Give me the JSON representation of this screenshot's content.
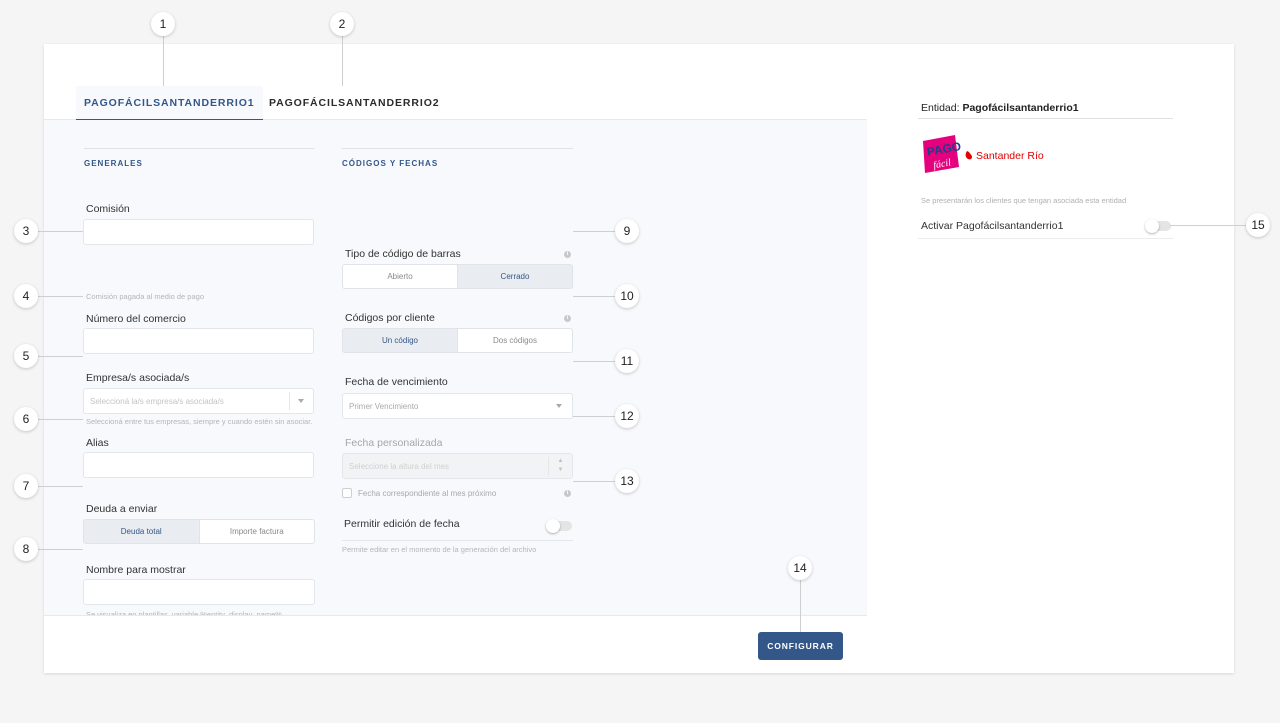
{
  "tabs": [
    {
      "label": "PAGOFÁCILSANTANDERRIO1",
      "active": true
    },
    {
      "label": "PAGOFÁCILSANTANDERRIO2",
      "active": false
    }
  ],
  "sections": {
    "generales": "GENERALES",
    "codigos": "CÓDIGOS Y FECHAS"
  },
  "generales": {
    "comision_label": "Comisión",
    "comision_hint": "Comisión pagada al medio de pago",
    "numero_label": "Número del comercio",
    "empresas_label": "Empresa/s asociada/s",
    "empresas_placeholder": "Seleccioná la/s empresa/s asociada/s",
    "empresas_hint": "Seleccioná entre tus empresas, siempre y cuando estén sin asociar.",
    "alias_label": "Alias",
    "deuda_label": "Deuda a enviar",
    "deuda_options": [
      "Deuda total",
      "Importe factura"
    ],
    "nombre_label": "Nombre para mostrar",
    "nombre_hint": "Se visualiza en plantillas, variable %entity_display_name%"
  },
  "codigos": {
    "tipo_label": "Tipo de código de barras",
    "tipo_options": [
      "Abierto",
      "Cerrado"
    ],
    "porcliente_label": "Códigos por cliente",
    "porcliente_options": [
      "Un código",
      "Dos códigos"
    ],
    "vencimiento_label": "Fecha de vencimiento",
    "vencimiento_value": "Primer Vencimiento",
    "personalizada_label": "Fecha personalizada",
    "personalizada_placeholder": "Seleccione la altura del mes",
    "mes_proximo_label": "Fecha correspondiente al mes próximo",
    "permitir_label": "Permitir edición de fecha",
    "permitir_hint": "Permite editar en el momento de la generación del archivo"
  },
  "footer": {
    "configurar": "CONFIGURAR"
  },
  "entity": {
    "label": "Entidad:",
    "name": "Pagofácilsantanderrio1",
    "logo_pago": "PAGO",
    "logo_facil": "fácil",
    "logo_bank": "Santander Río",
    "hint": "Se presentarán los clientes que tengan asociada esta entidad",
    "activar_label": "Activar Pagofácilsantanderrio1"
  },
  "info_glyph": "i",
  "spin_glyphs": {
    "up": "▲",
    "down": "▼"
  },
  "callouts": [
    "1",
    "2",
    "3",
    "4",
    "5",
    "6",
    "7",
    "8",
    "9",
    "10",
    "11",
    "12",
    "13",
    "14",
    "15"
  ],
  "colors": {
    "accent": "#34578a",
    "logo_pink": "#e5007e",
    "santander_red": "#e00000"
  }
}
